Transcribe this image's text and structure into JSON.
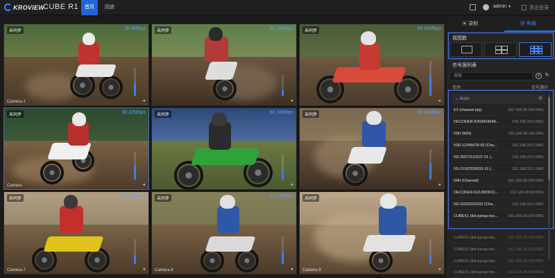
{
  "header": {
    "brand": "KROVIEW",
    "product": "CUBE R1",
    "tabs": [
      {
        "label": "首页",
        "active": true
      },
      {
        "label": "回放",
        "active": false
      }
    ],
    "user": "admin",
    "logout": "退出登录"
  },
  "tiles": [
    {
      "tag": "未同步",
      "rate": "30.4Mbps",
      "camera": "Camera-1",
      "level": 0.45
    },
    {
      "tag": "未同步",
      "rate": "34.15Mbps",
      "camera": "",
      "level": 0.3
    },
    {
      "tag": "未同步",
      "rate": "59.91Mbps",
      "camera": "",
      "level": 0.6
    },
    {
      "tag": "未同步",
      "rate": "30.32Mbps",
      "camera": "Camera",
      "level": 0.5
    },
    {
      "tag": "未同步",
      "rate": "54.16Mbps",
      "camera": "",
      "level": 0.4
    },
    {
      "tag": "未同步",
      "rate": "43.16Mbps",
      "camera": "",
      "level": 0.55
    },
    {
      "tag": "未同步",
      "rate": "23.20Mbps",
      "camera": "Camera-7",
      "level": 0.35
    },
    {
      "tag": "未同步",
      "rate": "27.22Mbps",
      "camera": "Camera-8",
      "level": 0.45
    },
    {
      "tag": "未同步",
      "rate": "",
      "camera": "Camera-9",
      "level": 0.4
    }
  ],
  "panel": {
    "tabs": [
      "录制",
      "布局"
    ],
    "layout_label": "视图数",
    "source_label": "信号源列表",
    "search_placeholder": "搜索",
    "col_name": "名称",
    "col_ip": "信号源IP",
    "group": "Auto",
    "sources": [
      {
        "name": "E3 (channel-pip)",
        "ip": "192.168.28.195:0961"
      },
      {
        "name": "DECODER-K203004048...",
        "ip": "192.168.28.0:0961"
      },
      {
        "name": "N30 (N30)",
        "ip": "192.168.28.118:0961"
      },
      {
        "name": "N30-12345678-93 (Cha...",
        "ip": "192.168.28.1:0961"
      },
      {
        "name": "N3-20072110107-21 (...",
        "ip": "192.168.28.1:0961"
      },
      {
        "name": "N3-21162520033-15 (...",
        "ip": "192.168.28.1:0961"
      },
      {
        "name": "N40 (Channel)",
        "ip": "192.168.28.224:0961"
      },
      {
        "name": "DECODER-K213003011...",
        "ip": "192.168.28.60:0961"
      },
      {
        "name": "N3-20232023202 (Cha...",
        "ip": "192.168.28.1:0961"
      },
      {
        "name": "CUBEX1 (dst-pangu-tes...",
        "ip": "192.168.28.209:0961"
      },
      {
        "name": "CUBEX1 (dst-pangu-tes...",
        "ip": "192.168.28.209:0961"
      },
      {
        "name": "CUBEX1 (dst-pangu-tes...",
        "ip": "192.168.28.209:0961"
      },
      {
        "name": "CUBEX1 (dst-pangu-tes...",
        "ip": "192.168.28.209:0961"
      },
      {
        "name": "CUBEX1 (dst-pangu-tes...",
        "ip": "192.168.28.209:0961"
      }
    ]
  },
  "colors": {
    "accent": "#1f66d6",
    "rate": "#5ea0ff",
    "panel_bg": "#242424"
  }
}
